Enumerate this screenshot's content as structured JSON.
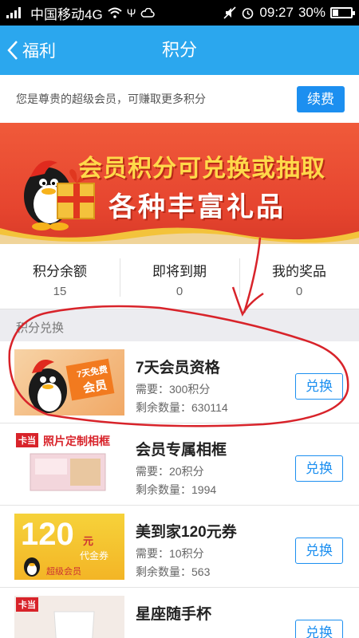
{
  "status_bar": {
    "carrier": "中国移动4G",
    "time": "09:27",
    "battery": "30%",
    "battery_level": 0.3
  },
  "nav": {
    "back_label": "福利",
    "title": "积分"
  },
  "notice": {
    "text": "您是尊贵的超级会员，可赚取更多积分",
    "button": "续费"
  },
  "banner": {
    "line1": "会员积分可兑换或抽取",
    "line2": "各种丰富礼品"
  },
  "stats": [
    {
      "label": "积分余额",
      "value": "15"
    },
    {
      "label": "即将到期",
      "value": "0"
    },
    {
      "label": "我的奖品",
      "value": "0"
    }
  ],
  "section_title": "积分兑换",
  "items": [
    {
      "name": "7天会员资格",
      "need": "需要：300积分",
      "remain": "剩余数量：630114",
      "button": "兑换",
      "thumb_text": [
        "7天免费",
        "会员"
      ]
    },
    {
      "name": "会员专属相框",
      "need": "需要：20积分",
      "remain": "剩余数量：1994",
      "button": "兑换",
      "thumb_text": [
        "卡当",
        "照片定制相框"
      ]
    },
    {
      "name": "美到家120元券",
      "need": "需要：10积分",
      "remain": "剩余数量：563",
      "button": "兑换",
      "thumb_text": [
        "120",
        "元",
        "代金券",
        "超级会员"
      ]
    },
    {
      "name": "星座随手杯",
      "need": "",
      "remain": "",
      "button": "兑换",
      "thumb_text": [
        "卡当"
      ]
    }
  ],
  "colors": {
    "nav_blue": "#2ba7ee",
    "button_blue": "#1c8ff0",
    "banner_red": "#e6452f",
    "annotation_red": "#d8232a"
  }
}
